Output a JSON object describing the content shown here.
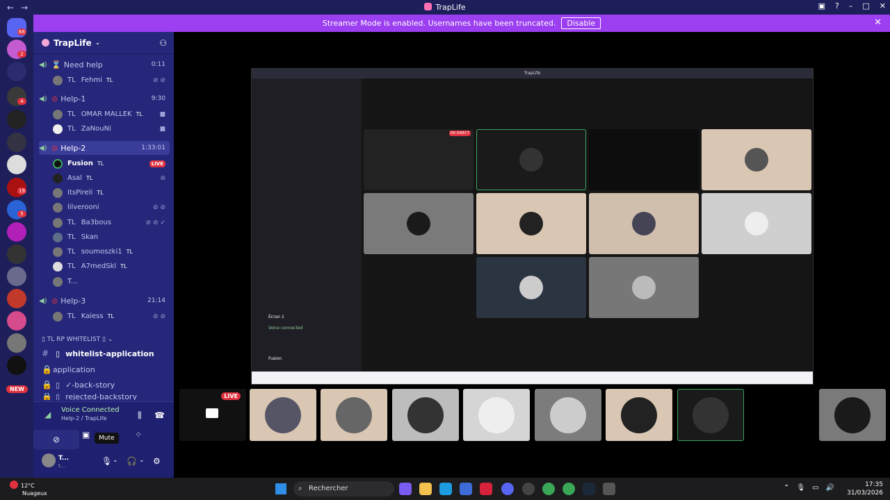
{
  "window": {
    "title": "TrapLife",
    "back": "←",
    "forward": "→"
  },
  "banner": {
    "text": "Streamer Mode is enabled. Usernames have been truncated.",
    "button": "Disable"
  },
  "rail": {
    "badges": [
      "66",
      "2",
      "4",
      "19",
      "5"
    ],
    "new_label": "NEW"
  },
  "server": {
    "name": "TrapLife"
  },
  "channels": [
    {
      "name": "Need help",
      "time": "0:11"
    },
    {
      "name": "Help-1",
      "time": "9:30"
    },
    {
      "name": "Help-2",
      "time": "1:33:01"
    },
    {
      "name": "Help-3",
      "time": "21:14"
    }
  ],
  "members": {
    "fehmi": "Fehmi",
    "omar": "OMAR MALLEK",
    "zanouni": "ZaNouNi",
    "fusion": "Fusion",
    "asal": "Asal",
    "itspireli": "ItsPireli",
    "lilverooni": "lilverooni",
    "ba3bous": "Ba3bous",
    "skan": "Skan",
    "soumoszki": "soumoszki1",
    "a7medskl": "A7medSkl",
    "truncated": "T...",
    "kaiess": "Kaiess",
    "tl": "TL",
    "live": "LIVE"
  },
  "category": {
    "name": "TL RP WHITELIST"
  },
  "text_channels": [
    {
      "name": "whitelist-application"
    },
    {
      "name": "application"
    },
    {
      "name": "✓-back-story"
    },
    {
      "name": "rejected-backstory"
    }
  ],
  "voice": {
    "status": "Voice Connected",
    "location": "Help-2 / TrapLife",
    "tooltip": "Mute"
  },
  "user": {
    "name": "T...",
    "sub": "t..."
  },
  "stream": {
    "live_label": "LIVE",
    "inner_title": "TrapLife",
    "inner_live": "EN DIRECT",
    "inner_ecran": "Écran 1",
    "inner_voice": "Voice connected",
    "inner_user": "Fusion"
  },
  "taskbar": {
    "temp": "12°C",
    "weather": "Nuageux",
    "search": "Rechercher",
    "time": "17:35",
    "date": "31/03/2026"
  }
}
